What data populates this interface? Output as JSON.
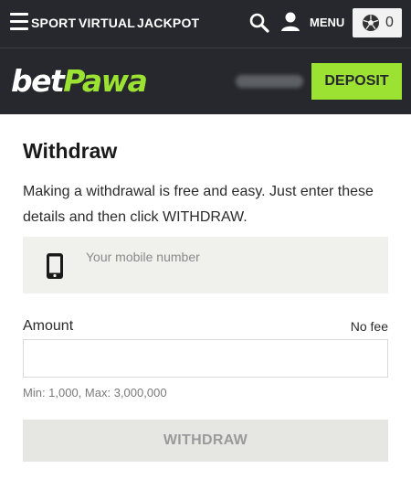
{
  "nav": {
    "menu_icon": "hamburger-icon",
    "links": [
      "SPORT",
      "VIRTUAL",
      "JACKPOT"
    ],
    "search_icon": "search-icon",
    "user_icon": "user-icon",
    "menu_label": "MENU",
    "betslip_icon": "soccer-ball-icon",
    "betslip_count": "0"
  },
  "brand": {
    "logo_part1": "bet",
    "logo_part2": "Pawa",
    "logo_colors": {
      "bet": "#ffffff",
      "pawa": "#9ce233"
    },
    "deposit_label": "DEPOSIT"
  },
  "withdraw": {
    "title": "Withdraw",
    "intro": "Making a withdrawal is free and easy. Just enter these details and then click WITHDRAW.",
    "phone_icon": "mobile-phone-icon",
    "phone_placeholder": "Your mobile number",
    "phone_value": "",
    "amount_label": "Amount",
    "fee_label": "No fee",
    "amount_value": "",
    "limits": "Min: 1,000, Max: 3,000,000",
    "button_label": "WITHDRAW"
  },
  "colors": {
    "header_bg": "#26282d",
    "accent": "#9ce233",
    "input_bg": "#f0f0ed",
    "button_disabled_bg": "#e6e6e3"
  }
}
